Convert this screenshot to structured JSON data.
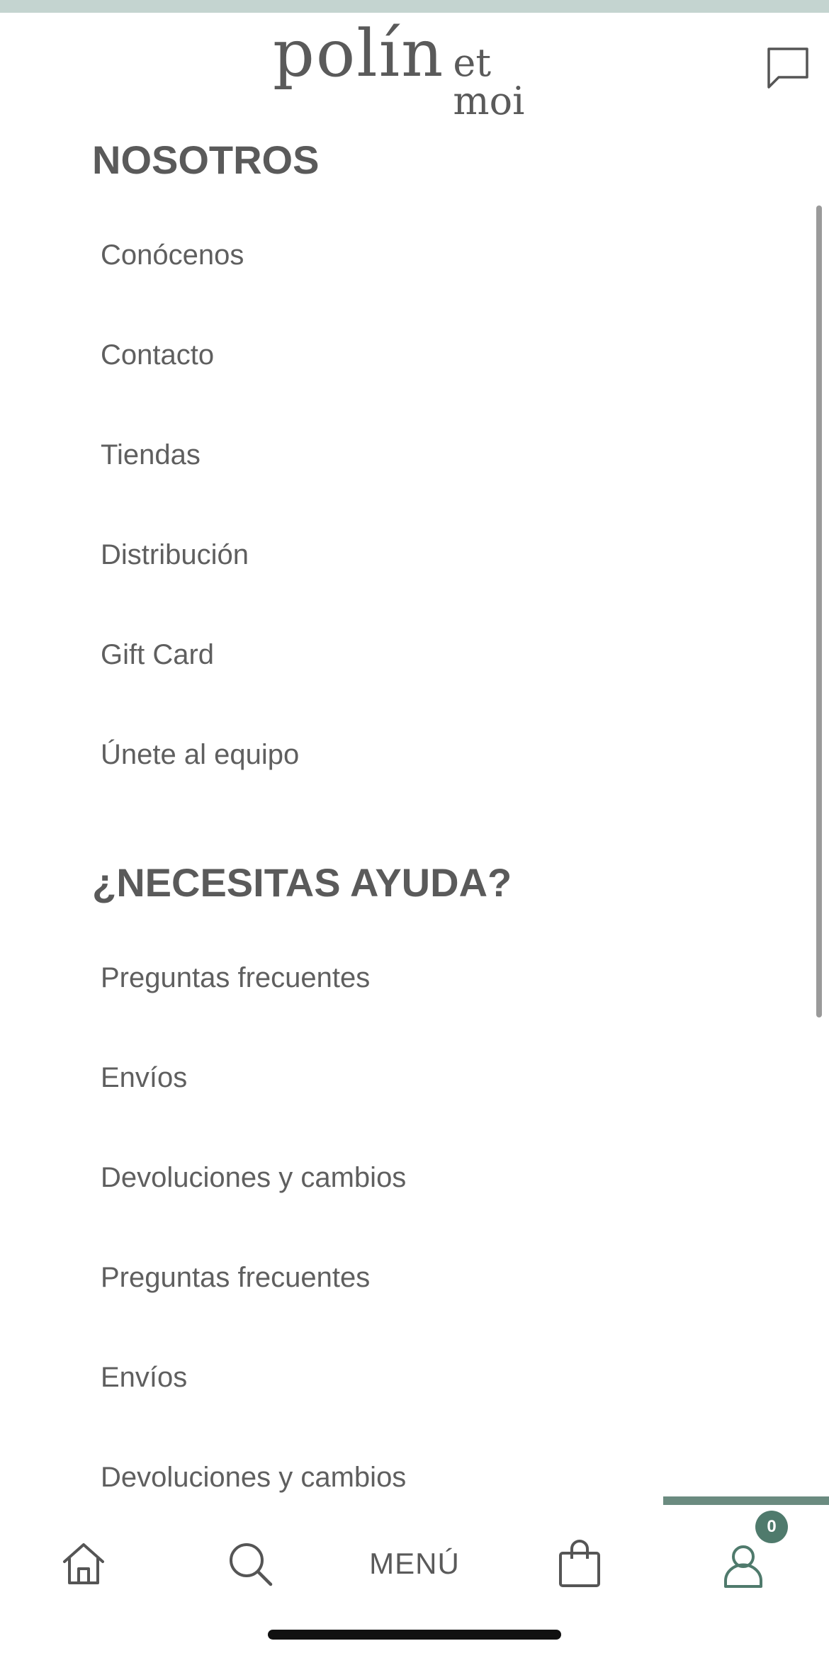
{
  "brand": {
    "logo_main": "polín",
    "logo_sub": "et moi"
  },
  "sections": [
    {
      "title": "NOSOTROS",
      "items": [
        "Conócenos",
        "Contacto",
        "Tiendas",
        "Distribución",
        "Gift Card",
        "Únete al equipo"
      ]
    },
    {
      "title": "¿NECESITAS AYUDA?",
      "items": [
        "Preguntas frecuentes",
        "Envíos",
        "Devoluciones y cambios",
        "Preguntas frecuentes",
        "Envíos",
        "Devoluciones y cambios"
      ]
    }
  ],
  "bottom_nav": {
    "home_icon": "home-icon",
    "search_icon": "search-icon",
    "menu_label": "MENÚ",
    "bag_icon": "shopping-bag-icon",
    "account_icon": "user-icon",
    "cart_count": "0"
  },
  "colors": {
    "accent": "#4f7a6c",
    "top_strip": "#c4d4d0",
    "text": "#5a5a5a"
  }
}
